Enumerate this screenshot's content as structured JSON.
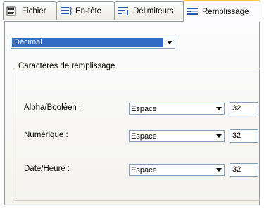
{
  "tabs": [
    {
      "label": "Fichier",
      "icon": "document-icon"
    },
    {
      "label": "En-tête",
      "icon": "header-lines-icon"
    },
    {
      "label": "Délimiteurs",
      "icon": "delimiters-icon"
    },
    {
      "label": "Remplissage",
      "icon": "fill-lines-icon"
    }
  ],
  "active_tab": "Remplissage",
  "format_select": {
    "value": "Décimal"
  },
  "group": {
    "title": "Caractères de remplissage",
    "rows": [
      {
        "label": "Alpha/Booléen :",
        "select_value": "Espace",
        "code": "32"
      },
      {
        "label": "Numérique :",
        "select_value": "Espace",
        "code": "32"
      },
      {
        "label": "Date/Heure :",
        "select_value": "Espace",
        "code": "32"
      }
    ]
  },
  "colors": {
    "accent": "#ffc83c",
    "selection": "#316ac5",
    "icon_blue": "#2456b4"
  }
}
